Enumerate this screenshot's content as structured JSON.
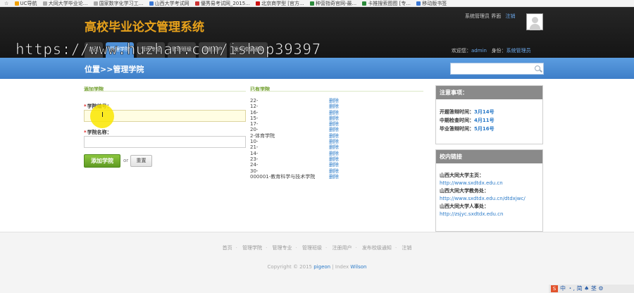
{
  "bookmarks": [
    "UC导航",
    "大同大学毕业论...",
    "国家数字化学习工...",
    "山西大学考试网",
    "優秀易考试网_2015...",
    "北京商学型 [官方...",
    "种营指奇官网-最...",
    "卡推搜索图图 [专...",
    "移动版书签"
  ],
  "header": {
    "site_title": "高校毕业论文管理系统",
    "system_admin_label": "系统管理员 界面",
    "logout": "注销",
    "welcome_label": "欢迎您：",
    "username": "admin",
    "identity_label": "身份：",
    "identity": "系统管理员",
    "nav_tabs": [
      "首页",
      "管理学院",
      "管理专业",
      "管理班级",
      "注册用户",
      "发布校级通知"
    ]
  },
  "watermark": "https://www.huzhan.com/ishop39397",
  "breadcrumb": "位置>>管理学院",
  "search": {
    "placeholder": ""
  },
  "add_form": {
    "section_title": "添加学院",
    "college_no_label": "学院编号：",
    "college_name_label": "学院名称：",
    "college_no_value": "",
    "college_name_value": "",
    "add_button": "添加学院",
    "or": "or",
    "reset_button": "重置"
  },
  "existing": {
    "section_title": "已有学院",
    "delete_label": "删除",
    "colleges": [
      "22-",
      "12-",
      "16-",
      "15-",
      "17-",
      "20-",
      "2-体育学院",
      "10-",
      "21-",
      "14-",
      "23-",
      "24-",
      "30-",
      "000001-教育科学与技术学院"
    ]
  },
  "notice_panel": {
    "title": "注意事项：",
    "items": [
      {
        "label": "开题答辩时间：",
        "value": "3月14号"
      },
      {
        "label": "中期检查时间：",
        "value": "4月11号"
      },
      {
        "label": "毕业答辩时间：",
        "value": "5月16号"
      }
    ]
  },
  "links_panel": {
    "title": "校内链接",
    "links": [
      {
        "title": "山西大同大学主页：",
        "url": "http://www.sxdtdx.edu.cn"
      },
      {
        "title": "山西大同大学教务处：",
        "url": "http://www.sxdtdx.edu.cn/dtdxjwc/"
      },
      {
        "title": "山西大同大学人事处：",
        "url": "http://zsjyc.sxdtdx.edu.cn"
      }
    ]
  },
  "footer": {
    "nav": [
      "首页",
      "管理学院",
      "管理专业",
      "管理班级",
      "注册用户",
      "发布校级通知",
      "注销"
    ],
    "copyright_prefix": "Copyright © 2015",
    "brand": "pigeon",
    "sep": "| Index",
    "author": "Wilson"
  },
  "tray_text": "中 ・, 简 ♠ 茎 ⚙"
}
